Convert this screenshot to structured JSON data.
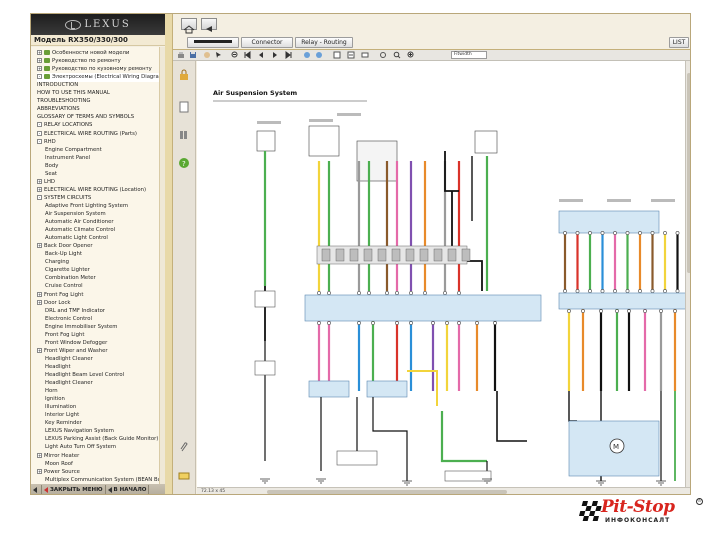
{
  "app": {
    "brand": "LEXUS",
    "model_title": "Модель RX350/330/300",
    "colors": {
      "brand_bar": "#2a2a2a",
      "panel_bg": "#f4efe2",
      "accent_red": "#d8251e",
      "tree_bg": "#fbf6e9"
    }
  },
  "header_tabs": [
    {
      "label": "Connector"
    },
    {
      "label": "Relay - Routing"
    },
    {
      "label": "LIST"
    }
  ],
  "toolbar": {
    "zoom_value": "Fitwidth",
    "icons": [
      "print-icon",
      "save-icon",
      "back-icon",
      "forward-icon",
      "first-page-icon",
      "prev-page-icon",
      "next-page-icon",
      "last-page-icon",
      "zoom-out-icon",
      "zoom-in-icon",
      "fit-page-icon"
    ]
  },
  "tree": {
    "items": [
      {
        "label": "Особенности новой модели",
        "level": 1,
        "exp": "+"
      },
      {
        "label": "Руководство по ремонту",
        "level": 1,
        "exp": "+"
      },
      {
        "label": "Руководство по кузовному ремонту",
        "level": 1,
        "exp": "+"
      },
      {
        "label": "Электросхемы (Electrical Wiring Diagram)",
        "level": 1,
        "exp": "-",
        "selected": true
      },
      {
        "label": "INTRODUCTION",
        "level": 2
      },
      {
        "label": "HOW TO USE THIS MANUAL",
        "level": 2
      },
      {
        "label": "TROUBLESHOOTING",
        "level": 2
      },
      {
        "label": "ABBREVIATIONS",
        "level": 2
      },
      {
        "label": "GLOSSARY OF TERMS AND SYMBOLS",
        "level": 2
      },
      {
        "label": "RELAY LOCATIONS",
        "level": 1,
        "exp": "-"
      },
      {
        "label": "ELECTRICAL WIRE ROUTING (Parts)",
        "level": 1,
        "exp": "-"
      },
      {
        "label": "RHD",
        "level": 2,
        "exp": "-"
      },
      {
        "label": "Engine Compartment",
        "level": 3
      },
      {
        "label": "Instrument Panel",
        "level": 3
      },
      {
        "label": "Body",
        "level": 3
      },
      {
        "label": "Seat",
        "level": 3
      },
      {
        "label": "LHD",
        "level": 2,
        "exp": "+"
      },
      {
        "label": "ELECTRICAL WIRE ROUTING (Location)",
        "level": 1,
        "exp": "+"
      },
      {
        "label": "SYSTEM CIRCUITS",
        "level": 1,
        "exp": "-"
      },
      {
        "label": "Adaptive Front Lighting System",
        "level": 3
      },
      {
        "label": "Air Suspension System",
        "level": 3
      },
      {
        "label": "Automatic Air Conditioner",
        "level": 3
      },
      {
        "label": "Automatic Climate Control",
        "level": 3
      },
      {
        "label": "Automatic Light Control",
        "level": 3
      },
      {
        "label": "Back Door Opener",
        "level": 2,
        "exp": "+"
      },
      {
        "label": "Back-Up Light",
        "level": 3
      },
      {
        "label": "Charging",
        "level": 3
      },
      {
        "label": "Cigarette Lighter",
        "level": 3
      },
      {
        "label": "Combination Meter",
        "level": 3
      },
      {
        "label": "Cruise Control",
        "level": 3
      },
      {
        "label": "Front Fog Light",
        "level": 2,
        "exp": "+"
      },
      {
        "label": "Door Lock",
        "level": 2,
        "exp": "+"
      },
      {
        "label": "DRL and TMF Indicator",
        "level": 3
      },
      {
        "label": "Electronic Control",
        "level": 3
      },
      {
        "label": "Engine Immobiliser System",
        "level": 3
      },
      {
        "label": "Front Fog Light",
        "level": 3
      },
      {
        "label": "Front Window Defogger",
        "level": 3
      },
      {
        "label": "Front Wiper and Washer",
        "level": 2,
        "exp": "+"
      },
      {
        "label": "Headlight Cleaner",
        "level": 3
      },
      {
        "label": "Headlight",
        "level": 3
      },
      {
        "label": "Headlight Beam Level Control",
        "level": 3
      },
      {
        "label": "Headlight Cleaner",
        "level": 3
      },
      {
        "label": "Horn",
        "level": 3
      },
      {
        "label": "Ignition",
        "level": 3
      },
      {
        "label": "Illumination",
        "level": 3
      },
      {
        "label": "Interior Light",
        "level": 3
      },
      {
        "label": "Key Reminder",
        "level": 3
      },
      {
        "label": "LEXUS Navigation System",
        "level": 3
      },
      {
        "label": "LEXUS Parking Assist (Back Guide Monitor)",
        "level": 3
      },
      {
        "label": "Light Auto Turn Off System",
        "level": 3
      },
      {
        "label": "Mirror Heater",
        "level": 2,
        "exp": "+"
      },
      {
        "label": "Moon Roof",
        "level": 3
      },
      {
        "label": "Power Source",
        "level": 2,
        "exp": "+"
      },
      {
        "label": "Multiplex Communication System (BEAN Bus)",
        "level": 3
      }
    ]
  },
  "bottom_bar": {
    "close_menu": "ЗАКРЫТЬ МЕНЮ",
    "to_start": "В НАЧАЛО"
  },
  "diagram": {
    "title": "Air Suspension System",
    "wire_colors": {
      "yellow": "#f2d43b",
      "green": "#4caf50",
      "blue": "#2a8fd8",
      "pink": "#e46aa9",
      "orange": "#e88a2a",
      "black": "#111111",
      "brown": "#8a5a2b",
      "red": "#d9332a",
      "violet": "#8050b0",
      "light_green": "#8bd06a",
      "white": "#cfcfcf",
      "grey": "#9a9a9a",
      "box_fill": "#d4e7f4",
      "box_stroke": "#5a88b0"
    }
  },
  "status": {
    "page_info": "72.13 x 45"
  },
  "pitstop": {
    "main": "Pit-Stop",
    "sub": "ИНФОКОНСАЛТ",
    "reg": "®"
  }
}
